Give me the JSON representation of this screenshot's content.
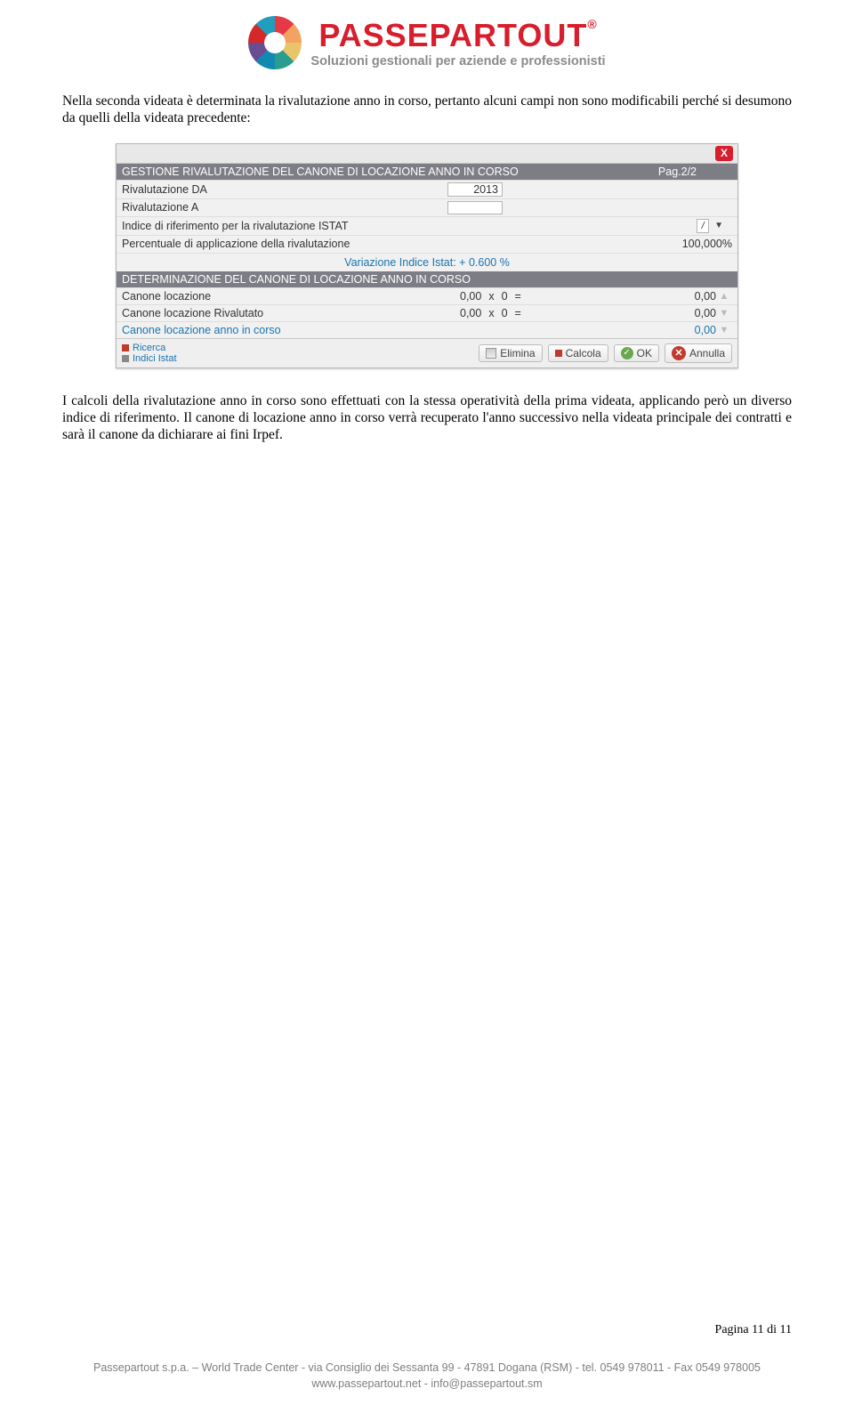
{
  "brand": {
    "name": "PASSEPARTOUT",
    "reg": "®",
    "sub": "Soluzioni gestionali per aziende e professionisti"
  },
  "para1": "Nella seconda videata è determinata la rivalutazione anno in corso, pertanto alcuni campi non sono modificabili perché si desumono da quelli della videata precedente:",
  "para2": "I calcoli della rivalutazione anno in corso sono effettuati con la stessa operatività della prima videata, applicando però un diverso indice di riferimento. Il canone di locazione anno in corso verrà recuperato l'anno successivo nella videata principale dei contratti e sarà il canone da dichiarare ai fini Irpef.",
  "app": {
    "close": "X",
    "sect1": {
      "title": "GESTIONE RIVALUTAZIONE DEL CANONE DI LOCAZIONE ANNO IN CORSO",
      "page": "Pag.2/2"
    },
    "rows": {
      "riv_da_label": "Rivalutazione DA",
      "riv_da_value": "2013",
      "riv_a_label": "Rivalutazione A",
      "riv_a_value": "",
      "indice_label": "Indice di riferimento per la rivalutazione ISTAT",
      "date_mark": "/",
      "percent_label": "Percentuale di applicazione della rivalutazione",
      "percent_value": "100,000%",
      "var_istat": "Variazione Indice Istat: + 0.600 %"
    },
    "sect2": {
      "title": "DETERMINAZIONE DEL CANONE DI LOCAZIONE ANNO IN CORSO"
    },
    "calc": {
      "loc_label": "Canone locazione",
      "loc_v1": "0,00",
      "loc_op1": "x",
      "loc_v2": "0",
      "loc_op2": "=",
      "loc_res": "0,00",
      "riv_label": "Canone locazione Rivalutato",
      "riv_v1": "0,00",
      "riv_op1": "x",
      "riv_v2": "0",
      "riv_op2": "=",
      "riv_res": "0,00",
      "corso_label": "Canone locazione anno in corso",
      "corso_res": "0,00"
    },
    "btmleft": {
      "ricerca": "Ricerca",
      "indici": "Indici Istat"
    },
    "buttons": {
      "elimina": "Elimina",
      "calcola": "Calcola",
      "ok": "OK",
      "annulla": "Annulla"
    }
  },
  "page_num": "Pagina 11 di 11",
  "footer1": "Passepartout s.p.a. – World Trade Center - via Consiglio dei Sessanta 99 - 47891 Dogana (RSM) - tel. 0549 978011 - Fax 0549 978005",
  "footer2": "www.passepartout.net - info@passepartout.sm"
}
